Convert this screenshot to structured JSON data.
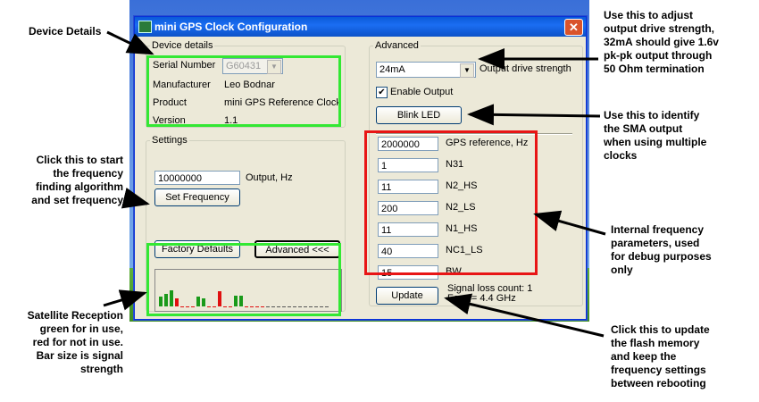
{
  "window": {
    "title": "mini GPS Clock Configuration",
    "close_glyph": "✕"
  },
  "device_details": {
    "legend": "Device details",
    "serial_label": "Serial Number",
    "serial_value": "G60431",
    "manufacturer_label": "Manufacturer",
    "manufacturer_value": "Leo Bodnar",
    "product_label": "Product",
    "product_value": "mini GPS Reference Clock",
    "version_label": "Version",
    "version_value": "1.1"
  },
  "settings": {
    "legend": "Settings",
    "output_value": "10000000",
    "output_label": "Output, Hz",
    "set_frequency_label": "Set Frequency",
    "factory_defaults_label": "Factory Defaults",
    "advanced_toggle_label": "Advanced  <<<"
  },
  "satellites": {
    "in_use_color": "#1a9a1a",
    "not_used_color": "#e01010",
    "bars": [
      {
        "strength": 0.35,
        "used": true
      },
      {
        "strength": 0.45,
        "used": true
      },
      {
        "strength": 0.6,
        "used": true
      },
      {
        "strength": 0.3,
        "used": false
      },
      {
        "strength": 0,
        "used": false
      },
      {
        "strength": 0,
        "used": false
      },
      {
        "strength": 0,
        "used": false
      },
      {
        "strength": 0.35,
        "used": true
      },
      {
        "strength": 0.3,
        "used": true
      },
      {
        "strength": 0,
        "used": false
      },
      {
        "strength": 0,
        "used": false
      },
      {
        "strength": 0.55,
        "used": false
      },
      {
        "strength": 0,
        "used": false
      },
      {
        "strength": 0,
        "used": false
      },
      {
        "strength": 0.4,
        "used": true
      },
      {
        "strength": 0.4,
        "used": true
      },
      {
        "strength": 0,
        "used": false
      },
      {
        "strength": 0,
        "used": false
      },
      {
        "strength": 0,
        "used": false
      },
      {
        "strength": 0,
        "used": false
      },
      {
        "strength": 0,
        "used": false
      },
      {
        "strength": 0,
        "used": false
      },
      {
        "strength": 0,
        "used": false
      },
      {
        "strength": 0,
        "used": false
      },
      {
        "strength": 0,
        "used": false
      },
      {
        "strength": 0,
        "used": false
      },
      {
        "strength": 0,
        "used": false
      },
      {
        "strength": 0,
        "used": false
      },
      {
        "strength": 0,
        "used": false
      },
      {
        "strength": 0,
        "used": false
      },
      {
        "strength": 0,
        "used": false
      },
      {
        "strength": 0,
        "used": false
      }
    ]
  },
  "advanced": {
    "legend": "Advanced",
    "drive_value": "24mA",
    "drive_label": "Output drive strength",
    "enable_output_label": "Enable Output",
    "enable_output_checked": true,
    "blink_led_label": "Blink LED",
    "params": [
      {
        "value": "2000000",
        "label": "GPS reference, Hz"
      },
      {
        "value": "1",
        "label": "N31"
      },
      {
        "value": "11",
        "label": "N2_HS"
      },
      {
        "value": "200",
        "label": "N2_LS"
      },
      {
        "value": "11",
        "label": "N1_HS"
      },
      {
        "value": "40",
        "label": "NC1_LS"
      },
      {
        "value": "15",
        "label": "BW"
      }
    ],
    "update_label": "Update",
    "signal_loss": "Signal loss count: 1",
    "fosc": "Fosc = 4.4 GHz"
  },
  "annotations": {
    "device_details": "Device Details",
    "set_frequency": [
      "Click this to start",
      "the frequency",
      "finding algorithm",
      "and set frequency"
    ],
    "satellite": [
      "Satellite Reception",
      "green for in use,",
      "red for not in use.",
      "Bar size is signal",
      "strength"
    ],
    "drive": [
      "Use this to adjust",
      "output drive strength,",
      "32mA should give 1.6v",
      "pk-pk output through",
      "50 Ohm termination"
    ],
    "blink": [
      "Use this to identify",
      "the SMA output",
      "when using multiple",
      "clocks"
    ],
    "internal": [
      "Internal frequency",
      "parameters, used",
      "for debug purposes",
      "only"
    ],
    "update": [
      "Click this to update",
      "the flash memory",
      "and keep the",
      "frequency settings",
      "between rebooting"
    ]
  }
}
